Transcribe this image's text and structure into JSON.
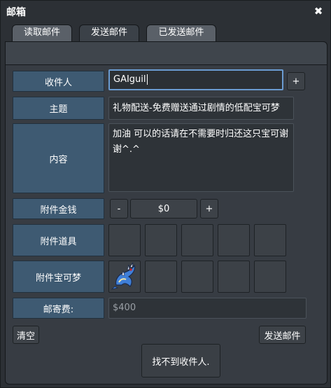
{
  "window": {
    "title": "邮箱",
    "close_icon": "close-icon"
  },
  "tabs": [
    {
      "label": "读取邮件",
      "state": "inactive"
    },
    {
      "label": "发送邮件",
      "state": "active"
    },
    {
      "label": "已发送邮件",
      "state": "inactive"
    }
  ],
  "form": {
    "recipient": {
      "label": "收件人",
      "value": "GAIguil",
      "add_button": "+"
    },
    "subject": {
      "label": "主题",
      "value": "礼物配送-免费赠送通过剧情的低配宝可梦"
    },
    "content": {
      "label": "内容",
      "value": "加油 可以的话请在不需要时归还这只宝可谢谢^.^"
    },
    "money": {
      "label": "附件金钱",
      "minus": "-",
      "value": "$0",
      "plus": "+"
    },
    "items": {
      "label": "附件道具"
    },
    "pokemon": {
      "label": "附件宝可梦",
      "attached": "gyarados-sprite"
    },
    "postage": {
      "label": "邮寄费:",
      "value": "$400"
    }
  },
  "actions": {
    "clear": "清空",
    "send": "发送邮件",
    "status_message": "找不到收件人."
  },
  "colors": {
    "label_bg": "#3e5a72",
    "panel_bg": "#373c43",
    "focus_border": "#6a9bd1"
  }
}
